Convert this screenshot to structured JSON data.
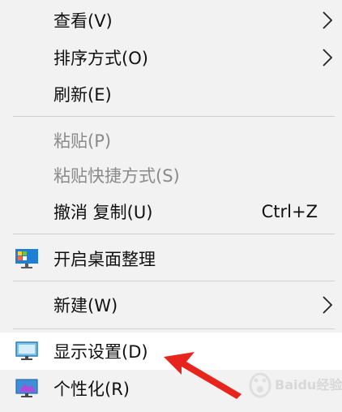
{
  "context_menu": {
    "view": {
      "label": "查看(V)"
    },
    "sort": {
      "label": "排序方式(O)"
    },
    "refresh": {
      "label": "刷新(E)"
    },
    "paste": {
      "label": "粘贴(P)"
    },
    "paste_shortcut": {
      "label": "粘贴快捷方式(S)"
    },
    "undo_copy": {
      "label": "撤消 复制(U)",
      "shortcut": "Ctrl+Z"
    },
    "desktop_organizer": {
      "label": "开启桌面整理",
      "icon": "desktop-organizer-icon"
    },
    "new": {
      "label": "新建(W)"
    },
    "display_settings": {
      "label": "显示设置(D)",
      "icon": "display-settings-icon"
    },
    "personalize": {
      "label": "个性化(R)",
      "icon": "personalize-icon"
    }
  },
  "watermark": {
    "text": "Baidu经验"
  },
  "colors": {
    "menu_background": "#f2f2f2",
    "highlight_background": "#ffffff",
    "disabled_text": "#8a8a8a",
    "annotation_arrow": "#e8251d"
  }
}
